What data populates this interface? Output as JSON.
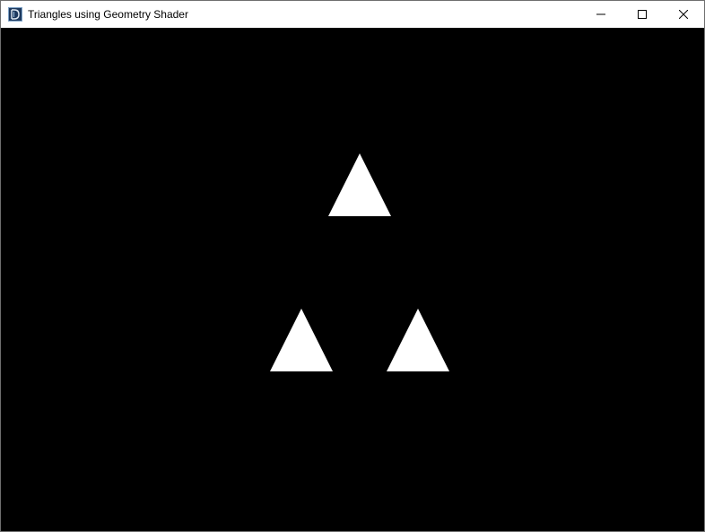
{
  "window": {
    "title": "Triangles using Geometry Shader",
    "icon": "app-logo-icon",
    "controls": [
      "minimize-icon",
      "maximize-icon",
      "close-icon"
    ]
  },
  "scene": {
    "background_color": "#000000",
    "triangle_color": "#ffffff",
    "triangle_count": 3
  }
}
